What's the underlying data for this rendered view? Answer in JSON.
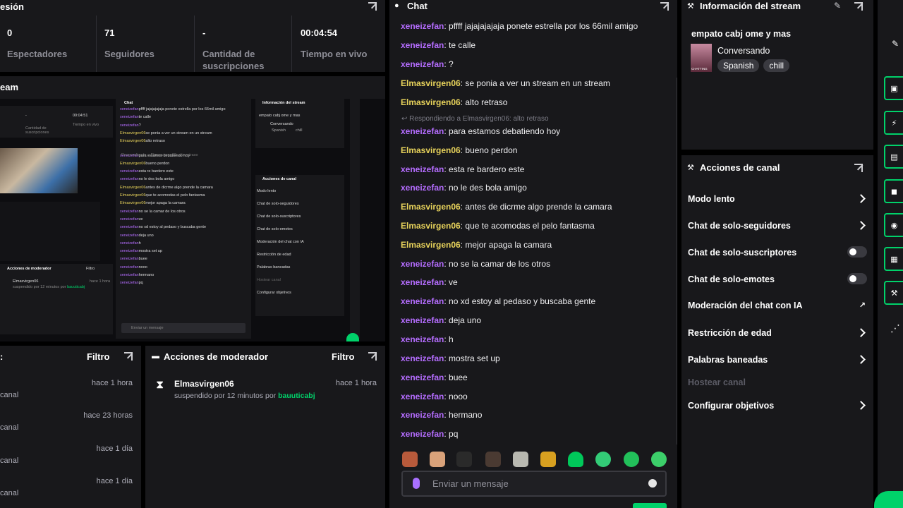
{
  "session": {
    "title": "esión",
    "stats": [
      {
        "value": "0",
        "label": "Espectadores"
      },
      {
        "value": "71",
        "label": "Seguidores"
      },
      {
        "value": "-",
        "label": "Cantidad de suscripciones"
      },
      {
        "value": "00:04:54",
        "label": "Tiempo en vivo"
      }
    ]
  },
  "stream_preview": {
    "title": "eam",
    "mini": {
      "chat_title": "Chat",
      "info_title": "Información del stream",
      "info_stream": "empato cabj ome y mas",
      "info_category": "Conversando",
      "info_tags": [
        "Spanish",
        "chill"
      ],
      "actions_title": "Acciones de canal",
      "actions": [
        "Modo lento",
        "Chat de solo-seguidores",
        "Chat de solo-suscriptores",
        "Chat de solo-emotes",
        "Moderación del chat con IA",
        "Restricción de edad",
        "Palabras baneadas",
        "Hostear canal",
        "Configurar objetivos"
      ],
      "mod_title": "Acciones de moderador",
      "mod_filter": "Filtro",
      "mod_user": "Elmasvirgen06",
      "mod_time": "hace 1 hora",
      "mod_desc": "suspendido por 12 minutos por",
      "mod_by": "bauuticabj",
      "stat_dash": "-",
      "stat_sub": "Cantidad de suscripciones",
      "stat_time": "00:04:51",
      "stat_time_label": "Tiempo en vivo",
      "reply": "Respondiendo a Elmasvirgen06: alto retraso",
      "input": "Enviar un mensaje"
    }
  },
  "activity": {
    "filter": "Filtro",
    "items": [
      {
        "time": "hace 1 hora",
        "text": "canal"
      },
      {
        "time": "hace 23 horas",
        "text": "canal"
      },
      {
        "time": "hace 1 día",
        "text": "canal"
      },
      {
        "time": "hace 1 día",
        "text": "canal"
      }
    ]
  },
  "moderator": {
    "title": "Acciones de moderador",
    "filter": "Filtro",
    "user": "Elmasvirgen06",
    "time": "hace 1 hora",
    "desc": "suspendido por 12 minutos por",
    "by": "bauuticabj"
  },
  "chat": {
    "title": "Chat",
    "messages": [
      {
        "user": "xeneizefan",
        "text": "pffff jajajajajaja ponete estrella por los 66mil amigo"
      },
      {
        "user": "xeneizefan",
        "text": "te calle"
      },
      {
        "user": "xeneizefan",
        "text": "?"
      },
      {
        "user": "Elmasvirgen06",
        "text": "se ponia a ver un stream en un stream"
      },
      {
        "user": "Elmasvirgen06",
        "text": "alto retraso"
      },
      {
        "user": "xeneizefan",
        "text": "para estamos debatiendo hoy"
      },
      {
        "user": "Elmasvirgen06",
        "text": "bueno perdon"
      },
      {
        "user": "xeneizefan",
        "text": "esta re bardero este"
      },
      {
        "user": "xeneizefan",
        "text": "no le des bola amigo"
      },
      {
        "user": "Elmasvirgen06",
        "text": "antes de dicrme algo prende la camara"
      },
      {
        "user": "Elmasvirgen06",
        "text": "que te acomodas el pelo fantasma"
      },
      {
        "user": "Elmasvirgen06",
        "text": "mejor apaga la camara"
      },
      {
        "user": "xeneizefan",
        "text": "no se la camar de los otros"
      },
      {
        "user": "xeneizefan",
        "text": "ve"
      },
      {
        "user": "xeneizefan",
        "text": "no xd estoy al pedaso y buscaba gente"
      },
      {
        "user": "xeneizefan",
        "text": "deja uno"
      },
      {
        "user": "xeneizefan",
        "text": "h"
      },
      {
        "user": "xeneizefan",
        "text": "mostra set up"
      },
      {
        "user": "xeneizefan",
        "text": "buee"
      },
      {
        "user": "xeneizefan",
        "text": "nooo"
      },
      {
        "user": "xeneizefan",
        "text": "hermano"
      },
      {
        "user": "xeneizefan",
        "text": "pq"
      }
    ],
    "reply_note": "Respondiendo a Elmasvirgen06: alto retraso",
    "input_placeholder": "Enviar un mensaje"
  },
  "stream_info": {
    "title": "Información del stream",
    "stream_title": "empato cabj ome y mas",
    "category": "Conversando",
    "category_art": "CHATTING",
    "tags": [
      "Spanish",
      "chill"
    ]
  },
  "channel_actions": {
    "title": "Acciones de canal",
    "items": [
      {
        "label": "Modo lento",
        "control": "chevron"
      },
      {
        "label": "Chat de solo-seguidores",
        "control": "chevron"
      },
      {
        "label": "Chat de solo-suscriptores",
        "control": "toggle"
      },
      {
        "label": "Chat de solo-emotes",
        "control": "toggle"
      },
      {
        "label": "Moderación del chat con IA",
        "control": "external"
      },
      {
        "label": "Restricción de edad",
        "control": "chevron"
      },
      {
        "label": "Palabras baneadas",
        "control": "chevron"
      },
      {
        "label": "Hostear canal",
        "control": "disabled"
      },
      {
        "label": "Configurar objetivos",
        "control": "chevron"
      }
    ]
  },
  "colors": {
    "accent": "#00d26a",
    "user_purple": "#b56dff",
    "user_gold": "#e8d35b",
    "panel": "#18181b"
  },
  "icons": [
    "popout-icon",
    "chat-bubble-icon",
    "wrench-icon",
    "pencil-icon",
    "hourglass-icon",
    "chevron-right-icon",
    "emoji-icon",
    "mic-icon"
  ]
}
